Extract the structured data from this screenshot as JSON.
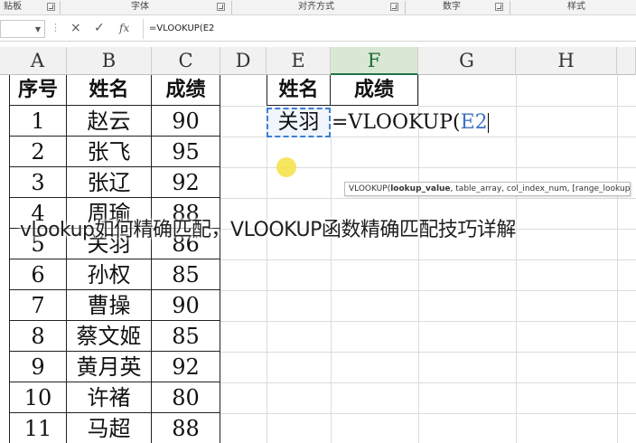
{
  "ribbon": {
    "groups": [
      "贴板",
      "字体",
      "对齐方式",
      "数字",
      "样式"
    ]
  },
  "formula_bar": {
    "name_box_value": "",
    "cancel_icon": "×",
    "confirm_icon": "✓",
    "fx_label": "fx",
    "formula": "=VLOOKUP(E2"
  },
  "columns": [
    "A",
    "B",
    "C",
    "D",
    "E",
    "F",
    "G",
    "H"
  ],
  "table": {
    "headers": [
      "序号",
      "姓名",
      "成绩"
    ],
    "rows": [
      [
        "1",
        "赵云",
        "90"
      ],
      [
        "2",
        "张飞",
        "95"
      ],
      [
        "3",
        "张辽",
        "92"
      ],
      [
        "4",
        "周瑜",
        "88"
      ],
      [
        "5",
        "关羽",
        "86"
      ],
      [
        "6",
        "孙权",
        "85"
      ],
      [
        "7",
        "曹操",
        "90"
      ],
      [
        "8",
        "蔡文姬",
        "85"
      ],
      [
        "9",
        "黄月英",
        "92"
      ],
      [
        "10",
        "许褚",
        "80"
      ],
      [
        "11",
        "马超",
        "88"
      ]
    ]
  },
  "lookup": {
    "header_name": "姓名",
    "header_score": "成绩",
    "name_value": "关羽",
    "formula_prefix": "=VLOOKUP(",
    "formula_ref": "E2"
  },
  "tooltip": {
    "func": "VLOOKUP(",
    "arg1": "lookup_value",
    "rest": ", table_array, col_index_num, [range_lookup])"
  },
  "overlay_title": "vlookup如何精确匹配，VLOOKUP函数精确匹配技巧详解",
  "colors": {
    "selected_header": "#d9e8d4",
    "accent": "#217346",
    "reference": "#3b72c4",
    "tooltip_border": "#bdbdbd"
  }
}
